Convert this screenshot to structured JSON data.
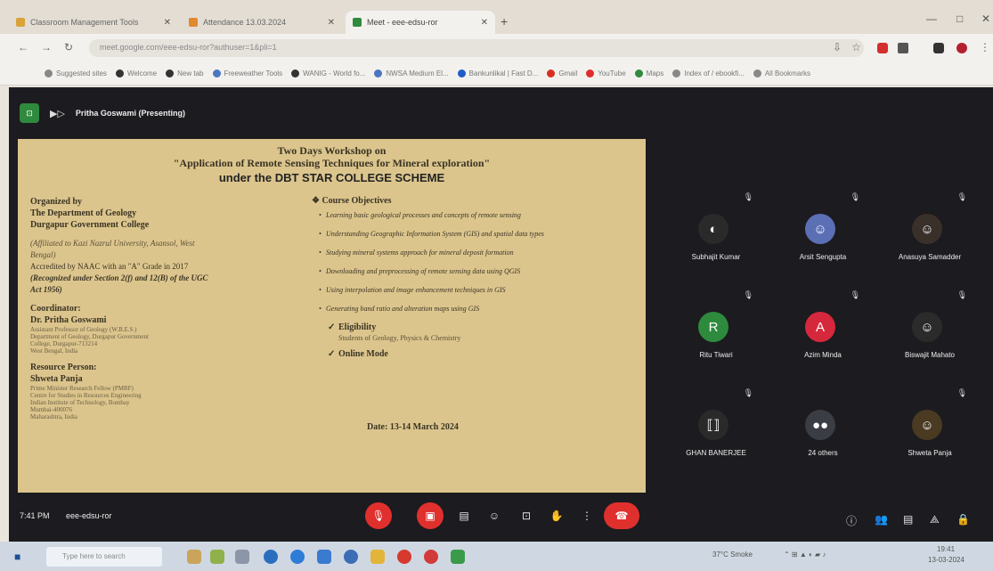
{
  "browser": {
    "tabs": [
      {
        "label": "Classroom Management Tools",
        "color": "#d9a33a",
        "active": false
      },
      {
        "label": "Attendance 13.03.2024",
        "color": "#e08a2e",
        "active": false
      },
      {
        "label": "Meet - eee-edsu-ror",
        "color": "#2f8a3e",
        "active": true
      }
    ],
    "url": "meet.google.com/eee-edsu-ror?authuser=1&pli=1",
    "bookmarks": [
      {
        "label": "Suggested sites",
        "color": "#888"
      },
      {
        "label": "Welcome",
        "color": "#333"
      },
      {
        "label": "New tab",
        "color": "#333"
      },
      {
        "label": "Freeweather Tools",
        "color": "#4a76c2"
      },
      {
        "label": "WANIG - World fo...",
        "color": "#333"
      },
      {
        "label": "NWSA Medium El...",
        "color": "#4a76c2"
      },
      {
        "label": "Bankunlikal | Fast D...",
        "color": "#1f5ec7"
      },
      {
        "label": "Gmail",
        "color": "#d93025"
      },
      {
        "label": "YouTube",
        "color": "#e02d2d"
      },
      {
        "label": "Maps",
        "color": "#2f8a3e"
      },
      {
        "label": "Index of / ebookfi...",
        "color": "#888"
      },
      {
        "label": "All Bookmarks",
        "color": "#888"
      }
    ]
  },
  "meet": {
    "presenter": "Pritha Goswami (Presenting)",
    "time": "7:41 PM",
    "code": "eee-edsu-ror",
    "slide": {
      "title1": "Two Days Workshop on",
      "title2": "\"Application of Remote Sensing Techniques for Mineral exploration\"",
      "title3": "under the DBT STAR COLLEGE SCHEME",
      "left": {
        "org_head": "Organized by",
        "org1": "The Department of Geology",
        "org2": "Durgapur Government College",
        "aff1": "(Affiliated to Kazi Nazrul University, Asansol, West",
        "aff2": "Bengal)",
        "acc": "Accredited by NAAC with an \"A\" Grade in 2017",
        "rec1": "(Recognized under Section 2(f) and 12(B) of the UGC",
        "rec2": "Act 1956)",
        "coord_head": "Coordinator:",
        "coord_name": "Dr. Pritha Goswami",
        "coord_l1": "Assistant Professor of Geology (W.B.E.S.)",
        "coord_l2": "Department of Geology, Durgapur Government",
        "coord_l3": "College, Durgapur-713214",
        "coord_l4": "West Bengal, India",
        "res_head": "Resource Person:",
        "res_name": "Shweta Panja",
        "res_l1": "Prime Minister Research Fellow (PMRF)",
        "res_l2": "Centre for Studies in Resources Engineering",
        "res_l3": "Indian Institute of Technology, Bombay",
        "res_l4": "Mumbai-400076",
        "res_l5": "Maharashtra, India"
      },
      "right": {
        "obj_head": "❖ Course Objectives",
        "objectives": [
          "Learning basic geological processes and concepts of remote sensing",
          "Understanding Geographic Information System (GIS) and spatial data types",
          "Studying mineral systems approach for mineral deposit formation",
          "Downloading and preprocessing of remote sensing data using QGIS",
          "Using interpolation and image enhancement techniques in GIS",
          "Generating band ratio and alteration maps using GIS"
        ],
        "elig_head": "Eligibility",
        "elig_text": "Students of Geology, Physics & Chemistry",
        "mode": "Online Mode",
        "date": "Date: 13-14 March 2024"
      }
    },
    "participants": [
      {
        "name": "Subhajit Kumar",
        "initial": "",
        "color": "#2a2a2a"
      },
      {
        "name": "Arsit Sengupta",
        "initial": "",
        "color": "#5b6fb5"
      },
      {
        "name": "Anasuya Samadder",
        "initial": "",
        "color": "#3a302a"
      },
      {
        "name": "Ritu Tiwari",
        "initial": "R",
        "color": "#2e8b3d"
      },
      {
        "name": "Azim Minda",
        "initial": "A",
        "color": "#d6283c"
      },
      {
        "name": "Biswajit Mahato",
        "initial": "",
        "color": "#2b2b2b"
      },
      {
        "name": "GHAN BANERJEE",
        "initial": "",
        "color": "#2a2a2a"
      },
      {
        "name": "24 others",
        "initial": "",
        "color": "#3a3d44"
      },
      {
        "name": "Shweta Panja",
        "initial": "",
        "color": "#4a3a22"
      }
    ]
  },
  "taskbar": {
    "search_placeholder": "Type here to search",
    "weather": "37°C Smoke",
    "time": "19:41",
    "date": "13-03-2024"
  }
}
